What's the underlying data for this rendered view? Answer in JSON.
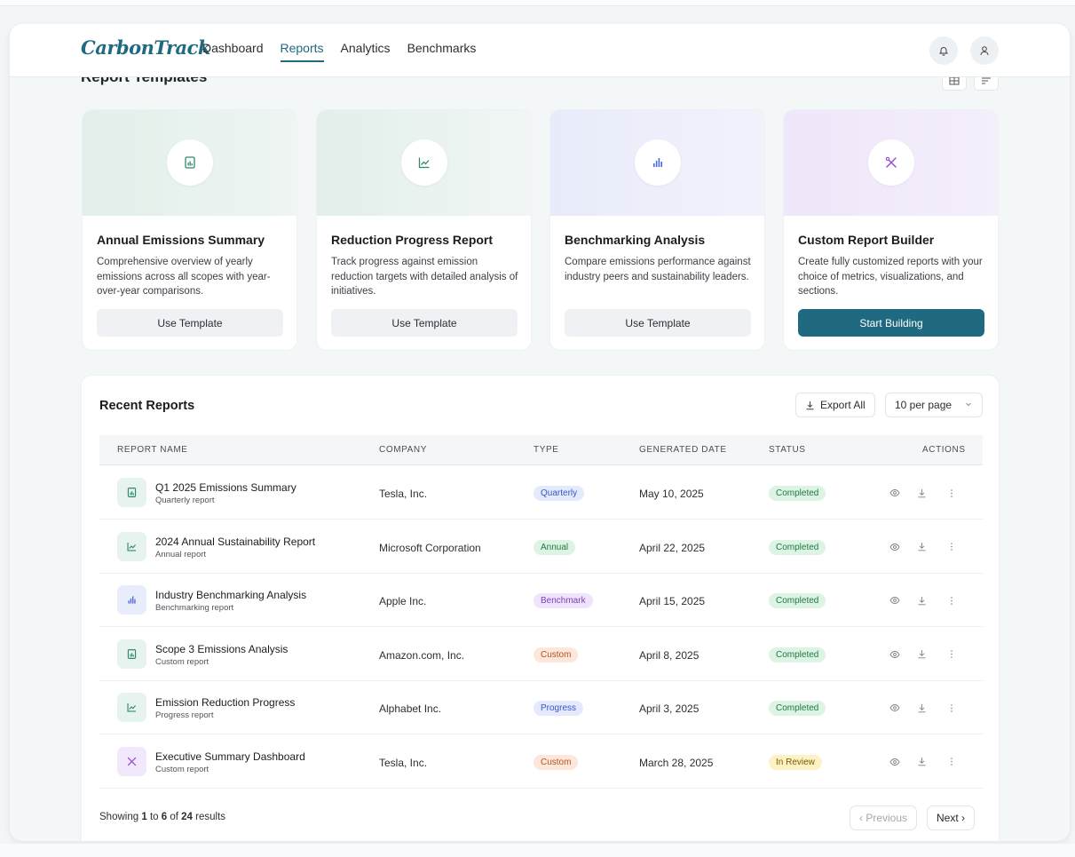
{
  "app": {
    "logo": "CarbonTrack"
  },
  "nav": [
    {
      "label": "Dashboard",
      "active": false
    },
    {
      "label": "Reports",
      "active": true
    },
    {
      "label": "Analytics",
      "active": false
    },
    {
      "label": "Benchmarks",
      "active": false
    }
  ],
  "templates": {
    "title": "Report Templates",
    "cards": [
      {
        "title": "Annual Emissions Summary",
        "description": "Comprehensive overview of yearly emissions across all scopes with year-over-year comparisons.",
        "button": "Use Template",
        "icon": "report-doc-icon",
        "tint": "#e6f3ee",
        "accent": "#2d8a6e"
      },
      {
        "title": "Reduction Progress Report",
        "description": "Track progress against emission reduction targets with detailed analysis of initiatives.",
        "button": "Use Template",
        "icon": "line-chart-icon",
        "tint": "#e6f4ee",
        "accent": "#2d8a6e"
      },
      {
        "title": "Benchmarking Analysis",
        "description": "Compare emissions performance against industry peers and sustainability leaders.",
        "button": "Use Template",
        "icon": "bar-chart-icon",
        "tint": "#ebeefc",
        "accent": "#4a6ee0"
      },
      {
        "title": "Custom Report Builder",
        "description": "Create fully customized reports with your choice of metrics, visualizations, and sections.",
        "button": "Start Building",
        "icon": "tools-icon",
        "tint": "#f2ebfb",
        "accent": "#9b4fd8"
      }
    ]
  },
  "recent": {
    "title": "Recent Reports",
    "export_label": "Export All",
    "per_page": "10 per page",
    "columns": [
      "REPORT NAME",
      "COMPANY",
      "TYPE",
      "GENERATED DATE",
      "STATUS",
      "ACTIONS"
    ],
    "rows": [
      {
        "name": "Q1 2025 Emissions Summary",
        "sub": "Quarterly report",
        "company": "Tesla, Inc.",
        "type": "Quarterly",
        "date": "May 10, 2025",
        "status": "Completed",
        "icon": "report-doc-icon"
      },
      {
        "name": "2024 Annual Sustainability Report",
        "sub": "Annual report",
        "company": "Microsoft Corporation",
        "type": "Annual",
        "date": "April 22, 2025",
        "status": "Completed",
        "icon": "line-chart-icon"
      },
      {
        "name": "Industry Benchmarking Analysis",
        "sub": "Benchmarking report",
        "company": "Apple Inc.",
        "type": "Benchmark",
        "date": "April 15, 2025",
        "status": "Completed",
        "icon": "bar-chart-icon"
      },
      {
        "name": "Scope 3 Emissions Analysis",
        "sub": "Custom report",
        "company": "Amazon.com, Inc.",
        "type": "Custom",
        "date": "April 8, 2025",
        "status": "Completed",
        "icon": "report-doc-icon"
      },
      {
        "name": "Emission Reduction Progress",
        "sub": "Progress report",
        "company": "Alphabet Inc.",
        "type": "Progress",
        "date": "April 3, 2025",
        "status": "Completed",
        "icon": "line-chart-icon"
      },
      {
        "name": "Executive Summary Dashboard",
        "sub": "Custom report",
        "company": "Tesla, Inc.",
        "type": "Custom",
        "date": "March 28, 2025",
        "status": "In Review",
        "icon": "tools-icon"
      }
    ],
    "footer": {
      "prefix": "Showing",
      "from": "1",
      "to_word": "to",
      "to": "6",
      "of_word": "of",
      "total": "24",
      "suffix": "results"
    },
    "pagination": {
      "previous": "‹ Previous",
      "next": "Next ›"
    }
  },
  "colors": {
    "brand": "#1f6a80",
    "completed_bg": "#ddf3e4",
    "completed_fg": "#1f7a45",
    "review_bg": "#fdf2c4",
    "review_fg": "#7a5a00"
  }
}
